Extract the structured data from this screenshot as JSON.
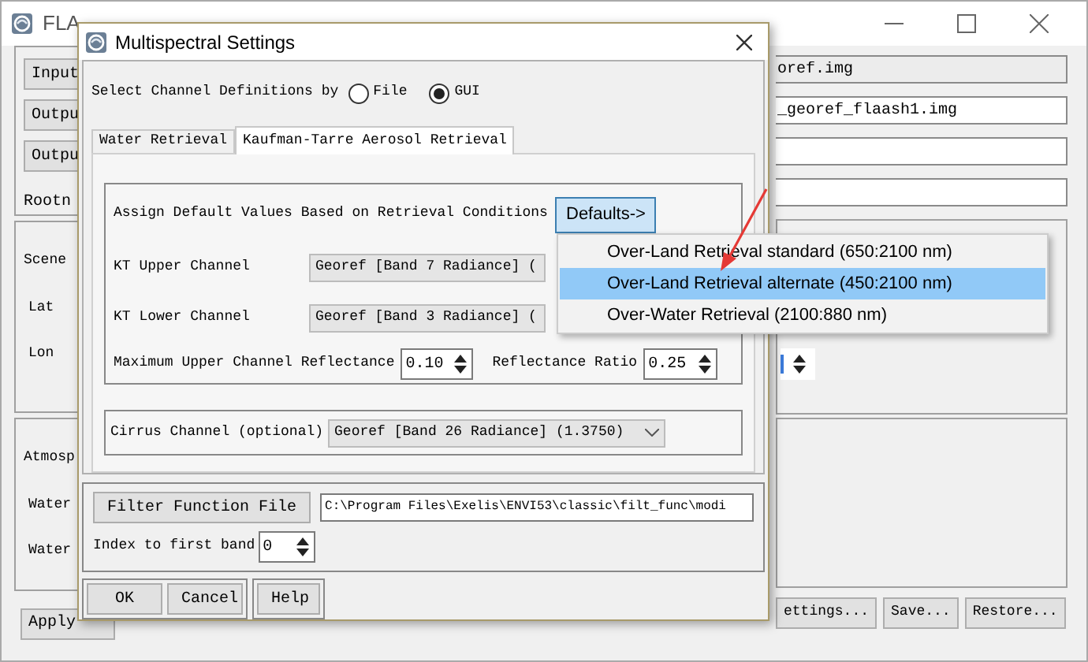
{
  "main_window": {
    "title": "FLA",
    "left_items": [
      {
        "kind": "button",
        "label": "Input"
      },
      {
        "kind": "button",
        "label": "Outpu"
      },
      {
        "kind": "button",
        "label": "Outpu"
      },
      {
        "kind": "label",
        "label": "Rootn"
      },
      {
        "kind": "group",
        "label": "Scene"
      },
      {
        "kind": "label",
        "label": "Lat"
      },
      {
        "kind": "label",
        "label": "Lon"
      },
      {
        "kind": "group",
        "label": "Atmosp"
      },
      {
        "kind": "label",
        "label": "Water"
      },
      {
        "kind": "label",
        "label": "Water"
      }
    ],
    "apply_button": "Apply",
    "fields": [
      {
        "value": "oref.img",
        "disabled": true
      },
      {
        "value": "_georef_flaash1.img",
        "disabled": false
      },
      {
        "disabled": false
      },
      {
        "disabled": false
      }
    ],
    "bottom_buttons": [
      "ettings...",
      "Save...",
      "Restore..."
    ]
  },
  "dialog": {
    "title": "Multispectral Settings",
    "channel_source": {
      "label": "Select Channel Definitions by",
      "options": [
        {
          "label": "File",
          "selected": false
        },
        {
          "label": "GUI",
          "selected": true
        }
      ]
    },
    "tabs": [
      {
        "label": "Water Retrieval",
        "selected": false
      },
      {
        "label": "Kaufman-Tarre Aerosol Retrieval",
        "selected": true
      }
    ],
    "defaults": {
      "label": "Assign Default Values Based on Retrieval Conditions",
      "button": "Defaults->"
    },
    "channels": [
      {
        "label": "KT Upper Channel",
        "value": "Georef [Band 7 Radiance] ("
      },
      {
        "label": "KT Lower Channel",
        "value": "Georef [Band 3 Radiance] ("
      }
    ],
    "max_reflectance": {
      "label": "Maximum Upper Channel Reflectance",
      "value": "0.10"
    },
    "ratio": {
      "label": "Reflectance Ratio",
      "value": "0.25"
    },
    "cirrus": {
      "label": "Cirrus Channel (optional)",
      "value": "Georef [Band 26 Radiance] (1.3750)"
    },
    "filter": {
      "button": "Filter Function File",
      "path": "C:\\Program Files\\Exelis\\ENVI53\\classic\\filt_func\\modi"
    },
    "index": {
      "label": "Index to first band",
      "value": "0"
    },
    "buttons": [
      "OK",
      "Cancel",
      "Help"
    ]
  },
  "menu": {
    "items": [
      {
        "label": "Over-Land Retrieval standard (650:2100 nm)",
        "selected": false
      },
      {
        "label": "Over-Land Retrieval alternate (450:2100 nm)",
        "selected": true
      },
      {
        "label": "Over-Water Retrieval (2100:880 nm)",
        "selected": false
      }
    ]
  }
}
